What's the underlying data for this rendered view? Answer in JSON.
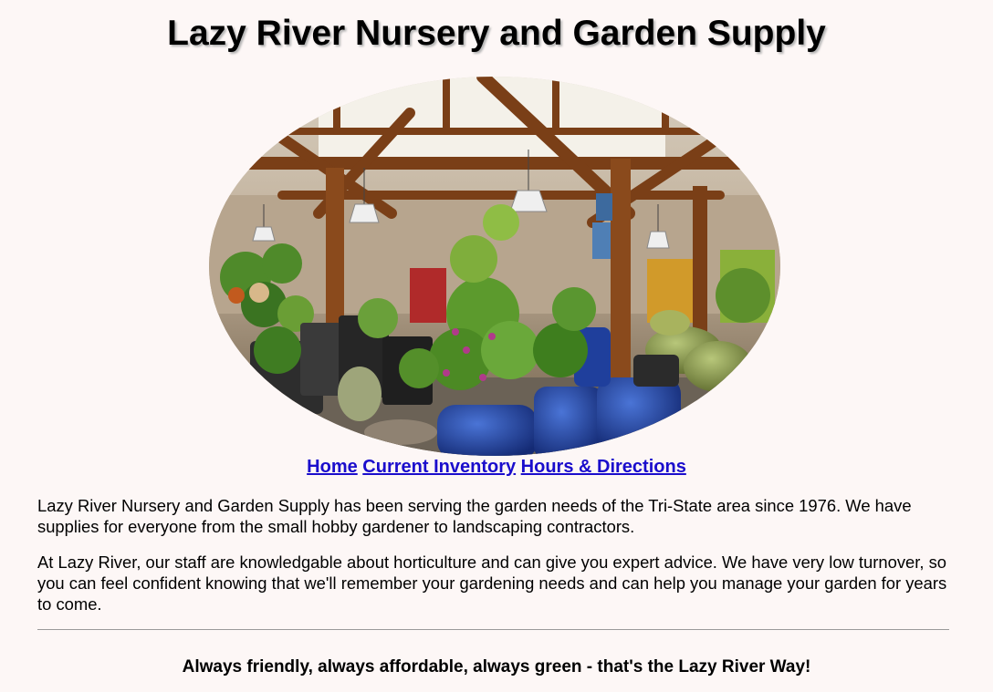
{
  "header": {
    "title": "Lazy River Nursery and Garden Supply"
  },
  "hero": {
    "icon": "garden-center-photo",
    "colors": {
      "wood": "#7a3f17",
      "sky": "#f4f1e9",
      "pot_blue": "#1f3f9c",
      "plant_green": "#4f8a2a"
    }
  },
  "nav": {
    "links": [
      {
        "label": "Home"
      },
      {
        "label": "Current Inventory"
      },
      {
        "label": "Hours & Directions"
      }
    ],
    "link_color": "#1a0dcc"
  },
  "main": {
    "paragraphs": [
      "Lazy River Nursery and Garden Supply has been serving the garden needs of the Tri-State area since 1976. We have supplies for everyone from the small hobby gardener to landscaping contractors.",
      "At Lazy River, our staff are knowledgable about horticulture and can give you expert advice. We have very low turnover, so you can feel confident knowing that we'll remember your gardening needs and can help you manage your garden for years to come."
    ]
  },
  "footer": {
    "tagline": "Always friendly, always affordable, always green - that's the Lazy River Way!"
  }
}
